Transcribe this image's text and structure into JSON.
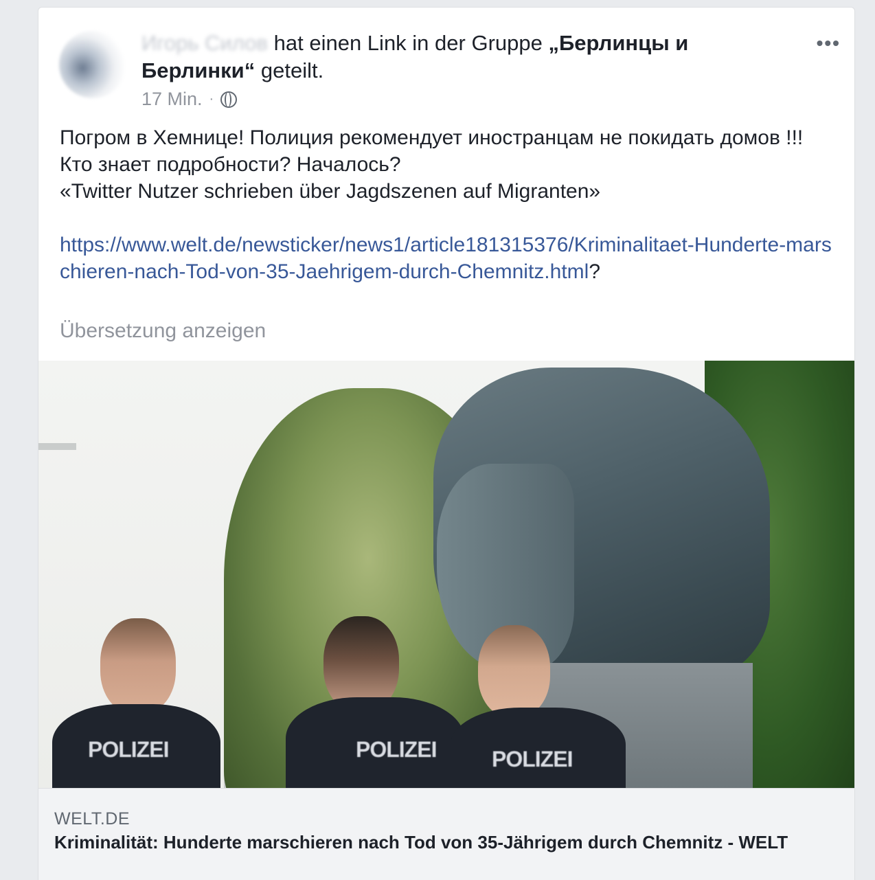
{
  "post": {
    "author_name": "Игорь Силов",
    "shared_text": "hat einen Link in der Gruppe",
    "group_name": "„Берлинцы и Берлинки“",
    "shared_suffix": "geteilt.",
    "time": "17 Min.",
    "separator": "·",
    "privacy_icon": "globe-icon",
    "more_label": "•••",
    "text_line1": "Погром в Хемнице! Полиция рекомендует иностранцам не покидать домов !!! Кто знает подробности? Началось?",
    "text_line2": "«Twitter Nutzer schrieben über Jagdszenen auf Migranten»",
    "link_url": "https://www.welt.de/newsticker/news1/article181315376/Kriminalitaet-Hunderte-marschieren-nach-Tod-von-35-Jaehrigem-durch-Chemnitz.html",
    "link_suffix": "?",
    "translate_label": "Übersetzung anzeigen"
  },
  "media": {
    "officer_labels": [
      "POLIZEI",
      "POLIZEI",
      "POLIZEI"
    ]
  },
  "link_preview": {
    "domain": "WELT.DE",
    "title": "Kriminalität: Hunderte marschieren nach Tod von 35-Jährigem durch Chemnitz - WELT"
  },
  "colors": {
    "link": "#385898",
    "text": "#1d2129",
    "muted": "#90949c",
    "background": "#e9ebee"
  }
}
